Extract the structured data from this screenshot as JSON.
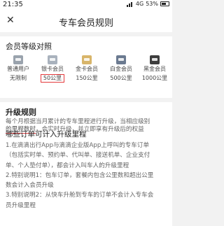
{
  "status": {
    "time": "21:35",
    "network": "4G",
    "battery": "53%"
  },
  "nav": {
    "title": "专车会员规则",
    "close_icon": "close-icon"
  },
  "levels": {
    "heading": "会员等级对照",
    "items": [
      {
        "name": "普通用户",
        "km": "无限制",
        "color": "#9aa3ad",
        "highlight": false
      },
      {
        "name": "银卡会员",
        "km": "50公里",
        "color": "#a9b2bd",
        "highlight": true
      },
      {
        "name": "金卡会员",
        "km": "150公里",
        "color": "#d8b56a",
        "highlight": false
      },
      {
        "name": "白金会员",
        "km": "500公里",
        "color": "#6b7a90",
        "highlight": false
      },
      {
        "name": "黑金会员",
        "km": "1000公里",
        "color": "#3d3d3d",
        "highlight": false
      }
    ]
  },
  "upgrade": {
    "heading": "升级规则",
    "line1": "每个月根据当月累计的专车里程进行升级，当相应级别",
    "line2_underlined": "的里程数时",
    "line2_rest": "，会实时升级，并立即享有升级后的权益"
  },
  "orders": {
    "heading": "哪些订单可计入升级里程",
    "lines": [
      "1.在滴滴出行App与滴滴企业版App上呼叫的专车订单",
      "（包括实时单、预约单、代叫单、接送机单、企业支付",
      "单、个人垫付单），都会计入叫车人的升级里程",
      "2.特别说明1：包车订单，套餐内包含公里数和超出公里",
      "数会计入会员升级",
      "3.特别说明2：从快车升舱到专车的订单不会计入专车会",
      "员升级里程"
    ]
  }
}
